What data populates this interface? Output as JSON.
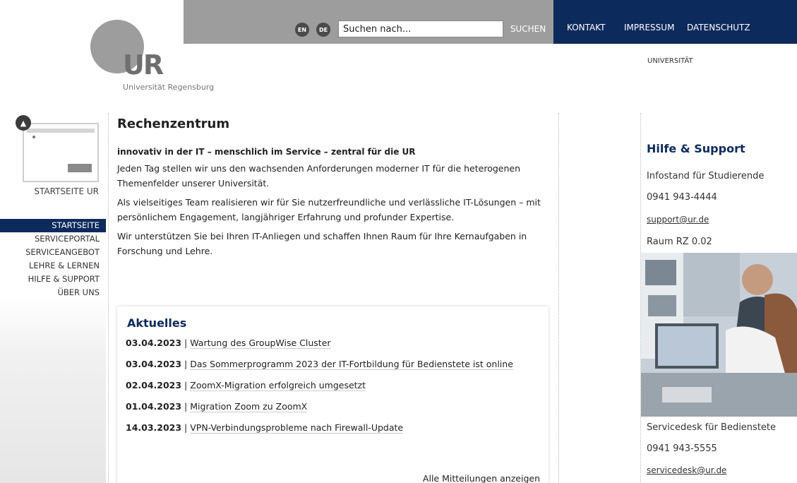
{
  "header": {
    "lang_en": "EN",
    "lang_de": "DE",
    "search_placeholder": "Suchen nach...",
    "search_button": "SUCHEN",
    "nav": [
      "KONTAKT",
      "IMPRESSUM",
      "DATENSCHUTZ"
    ],
    "universitaet": "UNIVERSITÄT"
  },
  "logo": {
    "letters": "UR",
    "text": "Universität Regensburg"
  },
  "sidebar": {
    "home_label": "STARTSEITE UR",
    "items": [
      {
        "label": "STARTSEITE",
        "active": true
      },
      {
        "label": "SERVICEPORTAL"
      },
      {
        "label": "SERVICEANGEBOT"
      },
      {
        "label": "LEHRE & LERNEN"
      },
      {
        "label": "HILFE & SUPPORT"
      },
      {
        "label": "ÜBER UNS"
      }
    ]
  },
  "main": {
    "title": "Rechenzentrum",
    "tagline": "innovativ in der IT – menschlich im Service – zentral für die UR",
    "paragraphs": [
      "Jeden Tag stellen wir uns den wachsenden Anforderungen moderner IT für die heterogenen Themenfelder unserer Universität.",
      "Als vielseitiges Team realisieren wir für Sie nutzerfreundliche und verlässliche IT-Lösungen – mit persönlichem Engagement, langjähriger Erfahrung und profunder Expertise.",
      "Wir unterstützen Sie bei Ihren IT-Anliegen und schaffen Ihnen Raum für Ihre Kernaufgaben in Forschung und Lehre."
    ]
  },
  "news": {
    "title": "Aktuelles",
    "items": [
      {
        "date": "03.04.2023",
        "text": "Wartung des GroupWise Cluster"
      },
      {
        "date": "03.04.2023",
        "text": "Das Sommerprogramm 2023 der IT-Fortbildung für Bedienstete ist online"
      },
      {
        "date": "02.04.2023",
        "text": "ZoomX-Migration erfolgreich umgesetzt"
      },
      {
        "date": "01.04.2023",
        "text": "Migration Zoom zu ZoomX"
      },
      {
        "date": "14.03.2023",
        "text": "VPN-Verbindungsprobleme nach Firewall-Update"
      }
    ],
    "all_link": "Alle Mitteilungen anzeigen"
  },
  "support": {
    "title": "Hilfe & Support",
    "students_label": "Infostand für Studierende",
    "students_phone": "0941 943-4444",
    "students_email": "support@ur.de",
    "students_room": "Raum RZ 0.02",
    "staff_label": "Servicedesk für Bedienstete",
    "staff_phone": "0941 943-5555",
    "staff_email": "servicedesk@ur.de"
  },
  "colors": {
    "navy": "#0d2a5c",
    "grey": "#9d9d9d"
  }
}
